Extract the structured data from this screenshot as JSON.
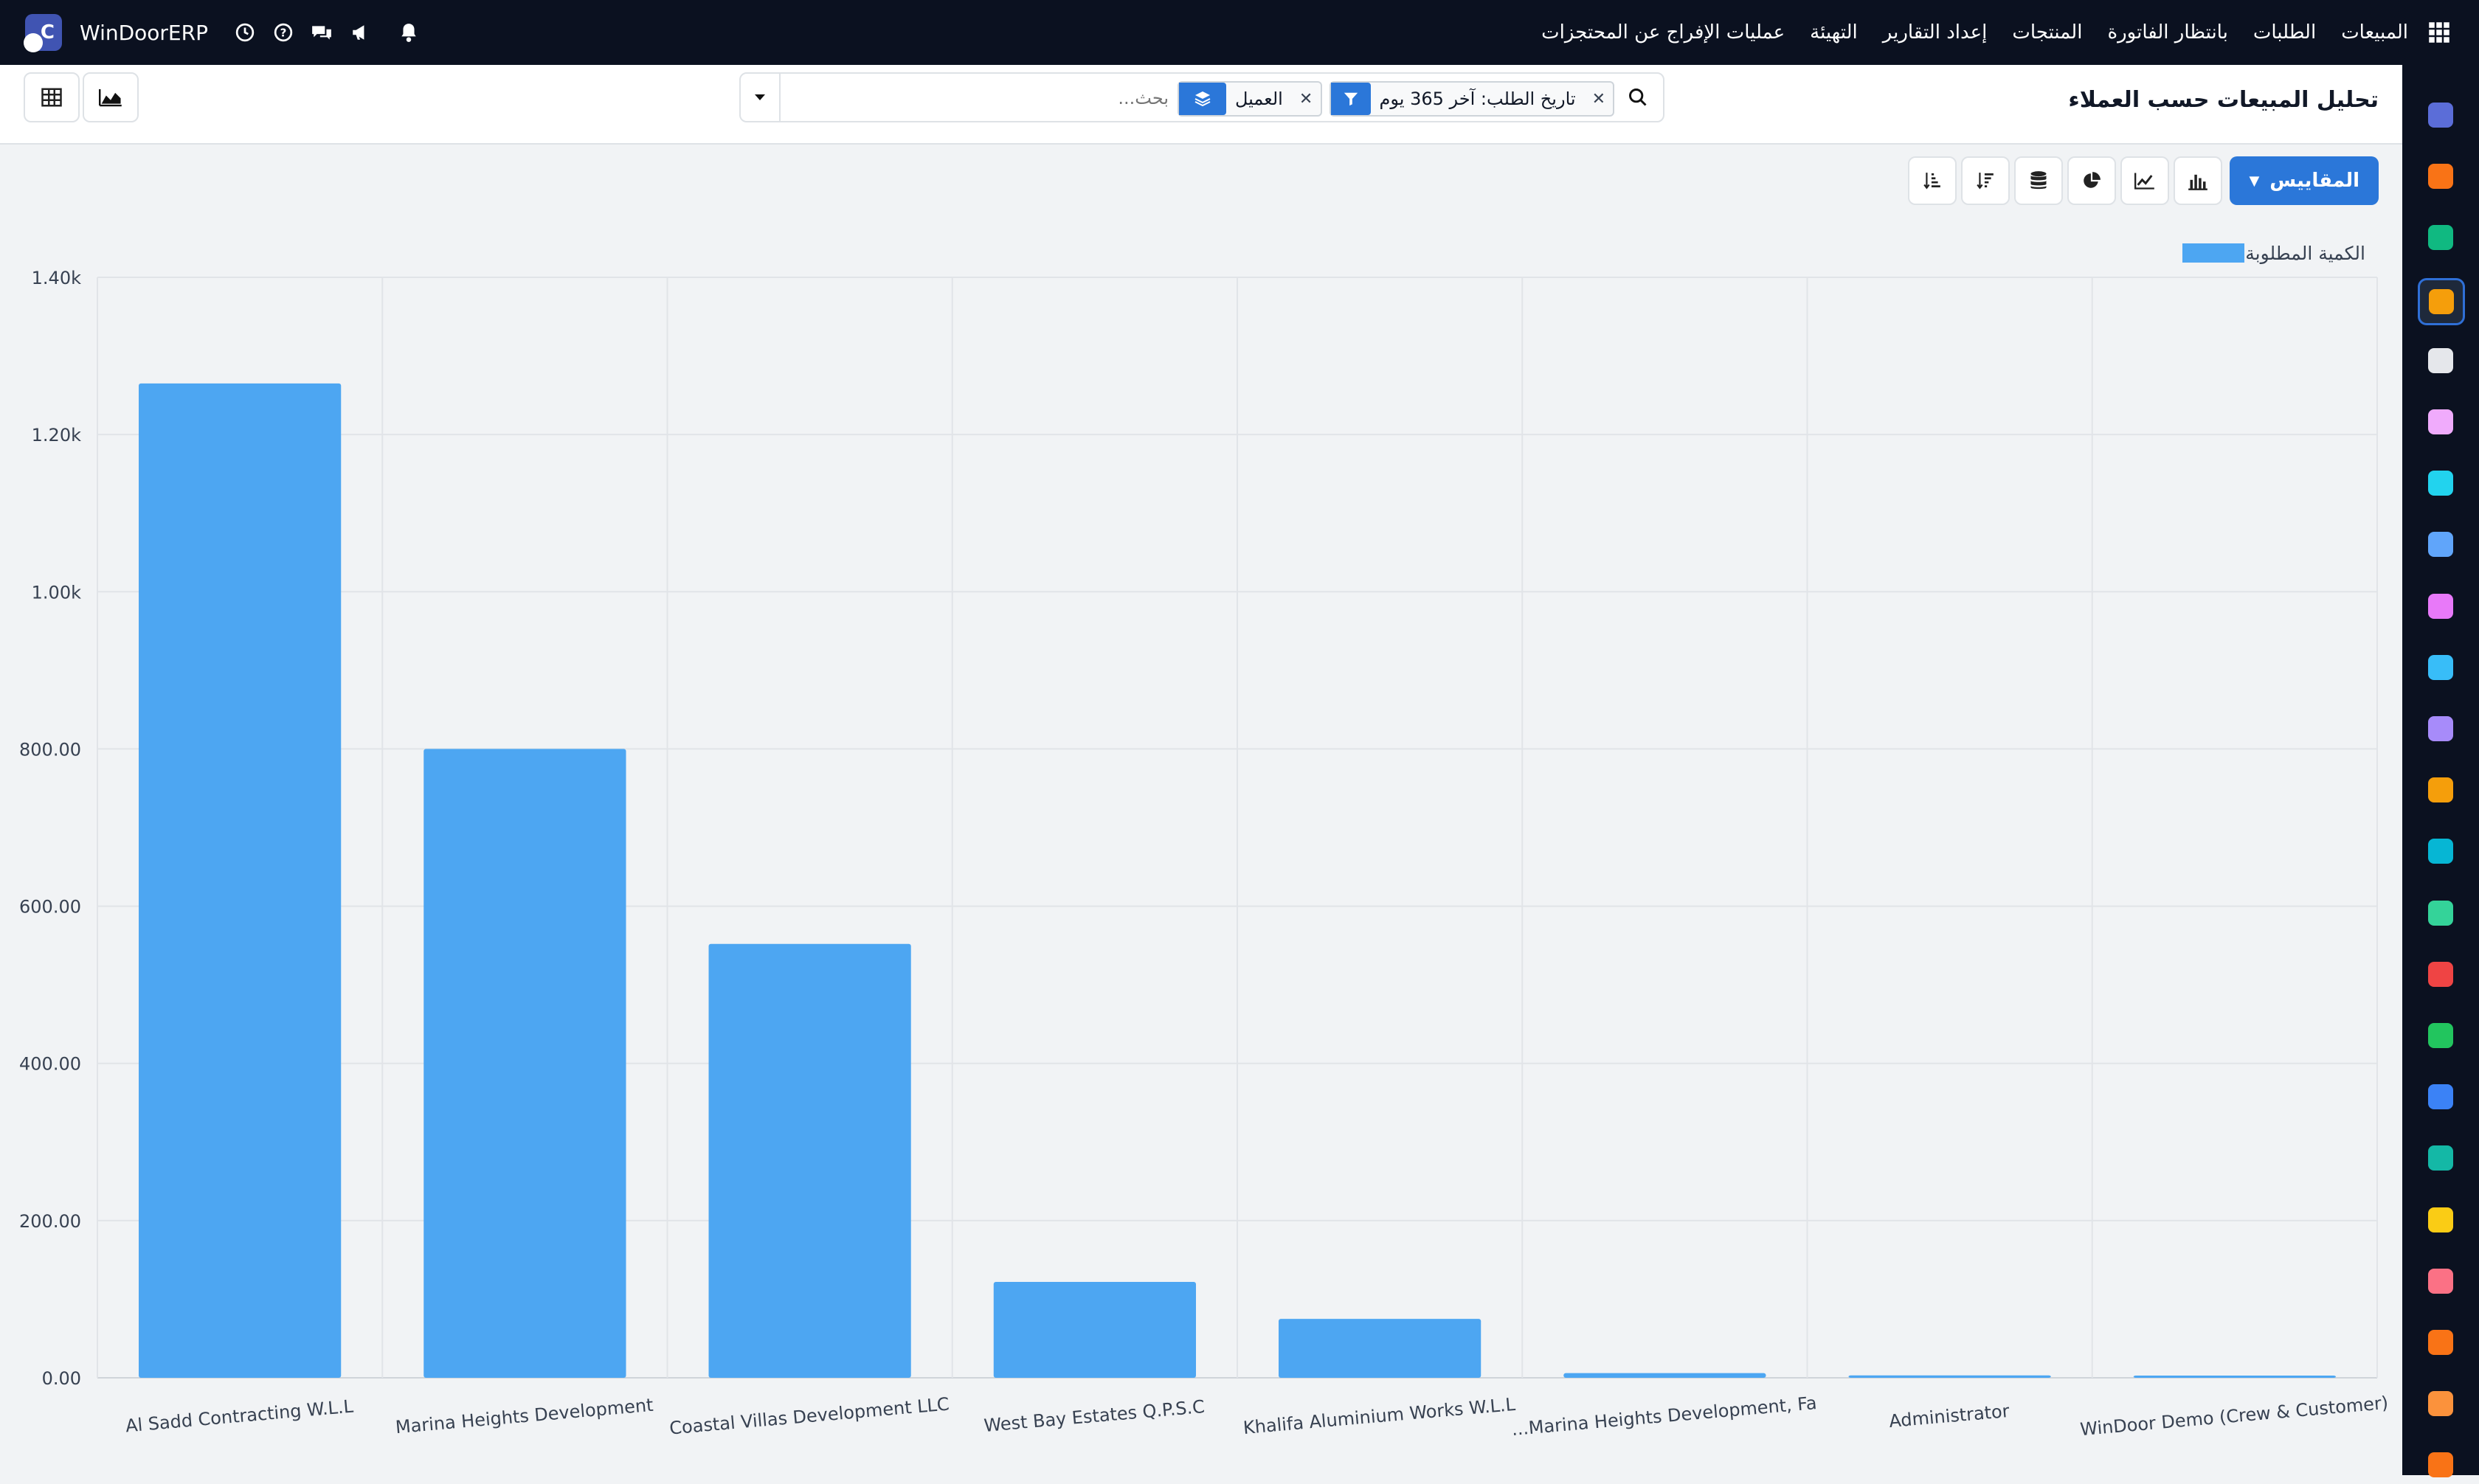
{
  "app": {
    "brand_name": "WinDoorERP",
    "logo_letter": "C",
    "menu": [
      "المبيعات",
      "الطلبات",
      "بانتظار الفاتورة",
      "المنتجات",
      "إعداد التقارير",
      "التهيئة",
      "عمليات الإفراج عن المحتجزات"
    ],
    "top_icons": [
      "clock-icon",
      "help-icon",
      "chat-icon",
      "megaphone-icon",
      "bell-icon"
    ]
  },
  "page": {
    "title": "تحليل المبيعات حسب العملاء",
    "search": {
      "placeholder": "بحث...",
      "filter_facet": "تاريخ الطلب: آخر 365 يوم",
      "groupby_facet": "العميل"
    },
    "view_buttons": [
      "graph-view-icon",
      "pivot-view-icon"
    ]
  },
  "toolbar": {
    "measures_label": "المقاييس",
    "buttons": [
      "bar-chart-icon",
      "line-chart-icon",
      "pie-chart-icon",
      "stacked-icon",
      "sort-descending-icon",
      "sort-ascending-icon"
    ]
  },
  "colors": {
    "navbar": "#0b1120",
    "accent": "#2b77d9",
    "bar": "#4da6f2"
  },
  "chart_data": {
    "type": "bar",
    "legend": "الكمية المطلوبة",
    "legend_position": "top-right",
    "grid": true,
    "ylim": [
      0,
      1400
    ],
    "yticks": [
      "0.00",
      "200.00",
      "400.00",
      "600.00",
      "800.00",
      "1.00k",
      "1.20k",
      "1.40k"
    ],
    "categories": [
      "Al Sadd Contracting W.L.L",
      "Marina Heights Development",
      "Coastal Villas Development LLC",
      "West Bay Estates Q.P.S.C",
      "Khalifa Aluminium Works W.L.L",
      "...Marina Heights Development, Fa",
      "Administrator",
      "WinDoor Demo (Crew & Customer)"
    ],
    "values": [
      1265,
      800,
      552,
      122,
      75,
      6,
      3,
      2
    ]
  },
  "rail": {
    "apps": [
      {
        "name": "mail-app-icon",
        "color": "#5b6dd8"
      },
      {
        "name": "chat-app-icon",
        "color": "#f97316"
      },
      {
        "name": "crm-app-icon",
        "color": "#10b981"
      },
      {
        "name": "sales-app-icon",
        "color": "#f59e0b"
      },
      {
        "name": "inventory-app-icon",
        "color": "#e5e7eb"
      },
      {
        "name": "photos-app-icon",
        "color": "#f0abfc"
      },
      {
        "name": "tasks-app-icon",
        "color": "#22d3ee"
      },
      {
        "name": "knowledge-app-icon",
        "color": "#60a5fa"
      },
      {
        "name": "products-app-icon",
        "color": "#e879f9"
      },
      {
        "name": "invoicing-app-icon",
        "color": "#38bdf8"
      },
      {
        "name": "employees-app-icon",
        "color": "#a78bfa"
      },
      {
        "name": "calendar-app-icon",
        "color": "#f59e0b"
      },
      {
        "name": "sign-app-icon",
        "color": "#06b6d4"
      },
      {
        "name": "contacts-app-icon",
        "color": "#34d399"
      },
      {
        "name": "dashboards-app-icon",
        "color": "#ef4444"
      },
      {
        "name": "whatsapp-app-icon",
        "color": "#22c55e"
      },
      {
        "name": "discuss-app-icon",
        "color": "#3b82f6"
      },
      {
        "name": "website-app-icon",
        "color": "#14b8a6"
      },
      {
        "name": "email-marketing-app-icon",
        "color": "#facc15"
      },
      {
        "name": "timesheet-app-icon",
        "color": "#fb7185"
      },
      {
        "name": "apps-store-icon",
        "color": "#f97316"
      },
      {
        "name": "studio-app-icon",
        "color": "#fb923c"
      },
      {
        "name": "settings-app-icon",
        "color": "#f97316"
      }
    ]
  }
}
